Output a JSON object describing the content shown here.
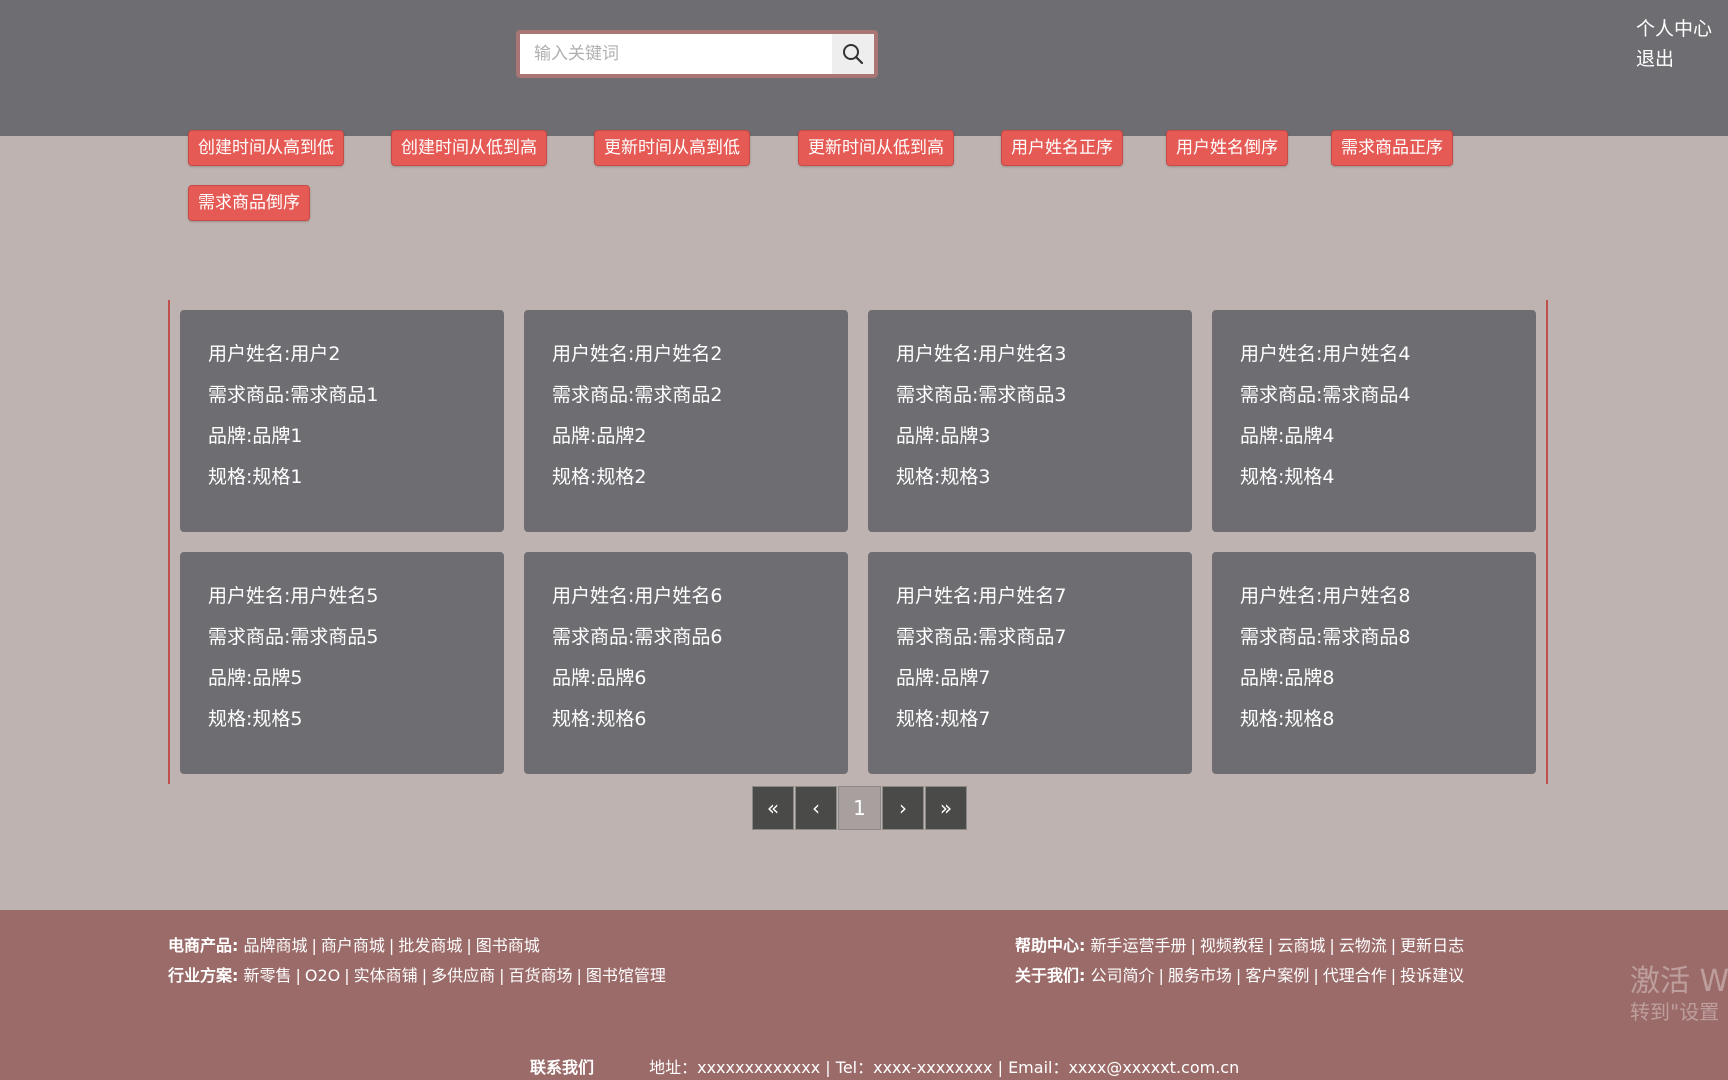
{
  "header": {
    "search_placeholder": "输入关键词",
    "user_center": "个人中心",
    "logout": "退出"
  },
  "sort_buttons": [
    "创建时间从高到低",
    "创建时间从低到高",
    "更新时间从高到低",
    "更新时间从低到高",
    "用户姓名正序",
    "用户姓名倒序",
    "需求商品正序",
    "需求商品倒序"
  ],
  "cards": [
    {
      "user": "用户姓名:用户2",
      "product": "需求商品:需求商品1",
      "brand": "品牌:品牌1",
      "spec": "规格:规格1"
    },
    {
      "user": "用户姓名:用户姓名2",
      "product": "需求商品:需求商品2",
      "brand": "品牌:品牌2",
      "spec": "规格:规格2"
    },
    {
      "user": "用户姓名:用户姓名3",
      "product": "需求商品:需求商品3",
      "brand": "品牌:品牌3",
      "spec": "规格:规格3"
    },
    {
      "user": "用户姓名:用户姓名4",
      "product": "需求商品:需求商品4",
      "brand": "品牌:品牌4",
      "spec": "规格:规格4"
    },
    {
      "user": "用户姓名:用户姓名5",
      "product": "需求商品:需求商品5",
      "brand": "品牌:品牌5",
      "spec": "规格:规格5"
    },
    {
      "user": "用户姓名:用户姓名6",
      "product": "需求商品:需求商品6",
      "brand": "品牌:品牌6",
      "spec": "规格:规格6"
    },
    {
      "user": "用户姓名:用户姓名7",
      "product": "需求商品:需求商品7",
      "brand": "品牌:品牌7",
      "spec": "规格:规格7"
    },
    {
      "user": "用户姓名:用户姓名8",
      "product": "需求商品:需求商品8",
      "brand": "品牌:品牌8",
      "spec": "规格:规格8"
    }
  ],
  "pagination": {
    "first": "«",
    "prev": "‹",
    "current": "1",
    "next": "›",
    "last": "»"
  },
  "footer": {
    "ecommerce_label": "电商产品:",
    "ecommerce_links": [
      "品牌商城",
      "商户商城",
      "批发商城",
      "图书商城"
    ],
    "industry_label": "行业方案:",
    "industry_links": [
      "新零售",
      "O2O",
      "实体商铺",
      "多供应商",
      "百货商场",
      "图书馆管理"
    ],
    "help_label": "帮助中心:",
    "help_links": [
      "新手运营手册",
      "视频教程",
      "云商城",
      "云物流",
      "更新日志"
    ],
    "about_label": "关于我们:",
    "about_links": [
      "公司简介",
      "服务市场",
      "客户案例",
      "代理合作",
      "投诉建议"
    ],
    "contact_label": "联系我们",
    "contact_info": "地址：xxxxxxxxxxxxx | Tel：xxxx-xxxxxxxx | Email：xxxx@xxxxxt.com.cn"
  },
  "watermark": {
    "line1": "激活 W",
    "line2": "转到\"设置"
  },
  "colors": {
    "header_bg": "#6e6d72",
    "page_bg": "#beb3b1",
    "sort_button": "#e65a55",
    "card_bg": "#6e6d72",
    "footer_bg": "#9a6b69"
  }
}
